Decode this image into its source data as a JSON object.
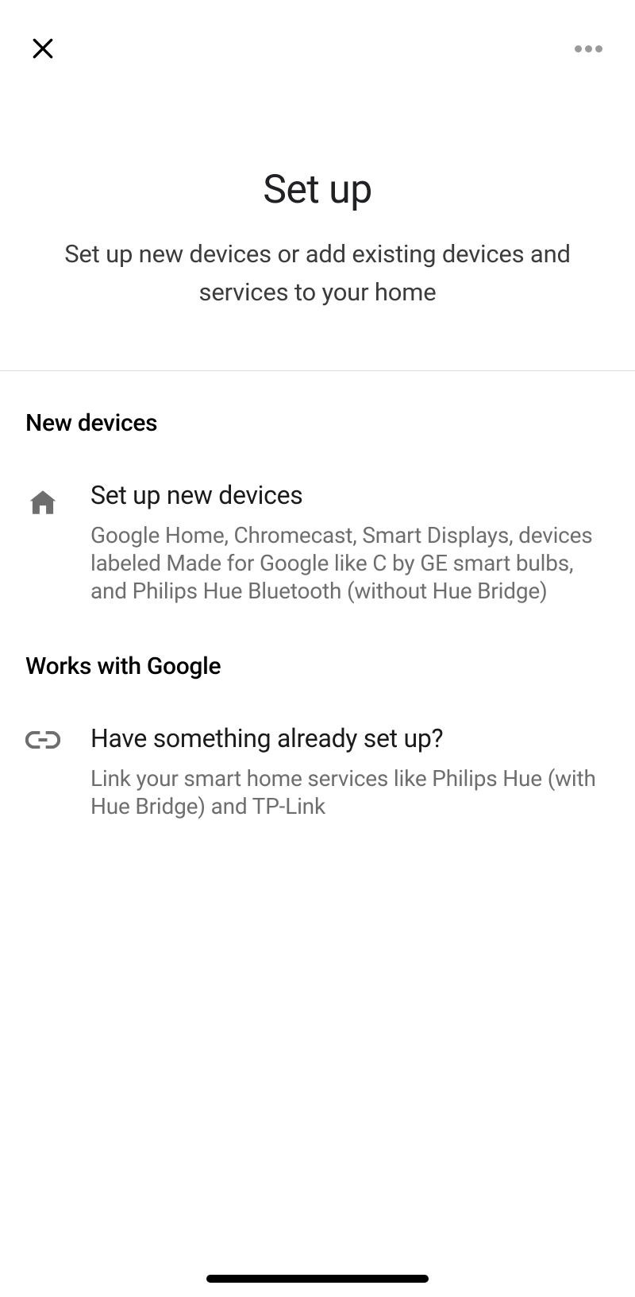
{
  "hero": {
    "title": "Set up",
    "subtitle": "Set up new devices or add existing devices and services to your home"
  },
  "sections": {
    "new_devices": {
      "header": "New devices",
      "item": {
        "title": "Set up new devices",
        "description": "Google Home, Chromecast, Smart Displays, devices labeled Made for Google like C by GE smart bulbs, and Philips Hue Bluetooth (without Hue Bridge)"
      }
    },
    "works_with_google": {
      "header": "Works with Google",
      "item": {
        "title": "Have something already set up?",
        "description": "Link your smart home services like Philips Hue (with Hue Bridge) and TP-Link"
      }
    }
  }
}
